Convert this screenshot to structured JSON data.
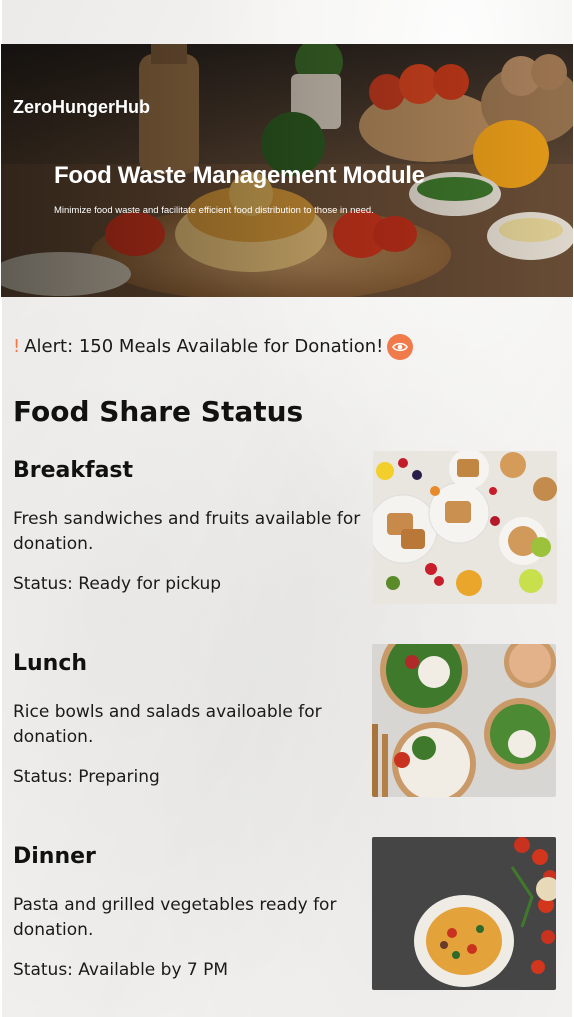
{
  "app": {
    "brand": "ZeroHungerHub"
  },
  "hero": {
    "title": "Food Waste Management Module",
    "subtitle": "Minimize food waste and facilitate efficient food distribution to those in need."
  },
  "alert": {
    "mark": "!",
    "text": "Alert: 150 Meals Available for Donation!",
    "icon": "eye-icon",
    "accent": "#f07a4a"
  },
  "section": {
    "title": "Food Share Status"
  },
  "meals": [
    {
      "name": "Breakfast",
      "description": "Fresh sandwiches and fruits available for donation.",
      "status": "Status: Ready for pickup"
    },
    {
      "name": "Lunch",
      "description": "Rice bowls and salads availoable for donation.",
      "status": "Status: Preparing"
    },
    {
      "name": "Dinner",
      "description": "Pasta and grilled vegetables ready for donation.",
      "status": "Status: Available by 7 PM"
    }
  ]
}
